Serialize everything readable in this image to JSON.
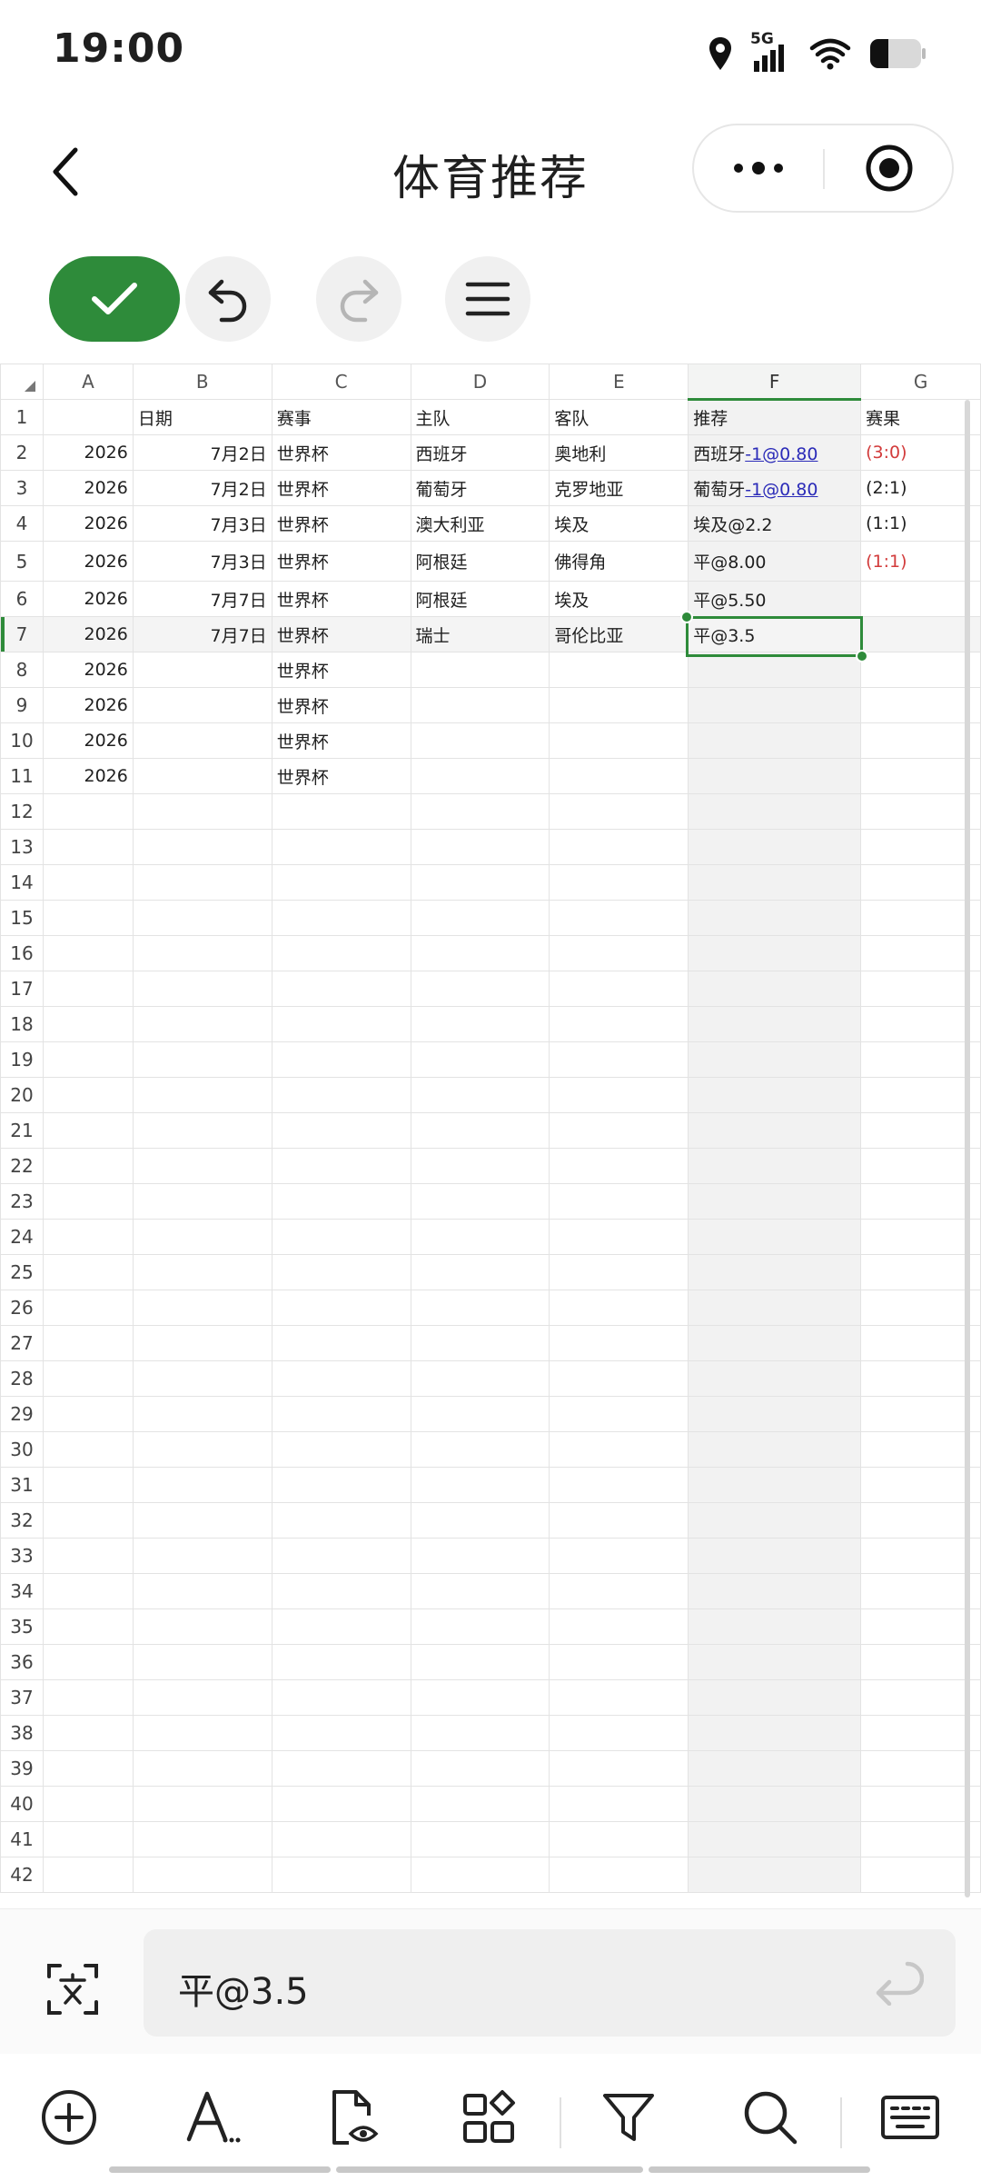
{
  "status_bar": {
    "time": "19:00",
    "network": "5G",
    "icons": [
      "location-icon",
      "signal-icon",
      "wifi-icon",
      "battery-icon"
    ]
  },
  "header": {
    "title": "体育推荐",
    "icons": [
      "back-icon",
      "more-icon",
      "target-icon"
    ]
  },
  "toolbar": {
    "icons": [
      "check-icon",
      "undo-icon",
      "redo-icon",
      "menu-icon"
    ],
    "accent": "#2e8b3a"
  },
  "sheet": {
    "columns": [
      "A",
      "B",
      "C",
      "D",
      "E",
      "F",
      "G"
    ],
    "selected_column": "F",
    "selected_row": 7,
    "selected_cell": "F7",
    "rows": [
      {
        "n": "1",
        "a": "",
        "b": "日期",
        "c": "赛事",
        "d": "主队",
        "e": "客队",
        "f_pre": "推荐",
        "f_link": "",
        "g": "赛果",
        "g_red": false
      },
      {
        "n": "2",
        "a": "2026",
        "b": "7月2日",
        "c": "世界杯",
        "d": "西班牙",
        "e": "奥地利",
        "f_pre": "西班牙",
        "f_link": "-1@0.80",
        "g": "(3:0)",
        "g_red": true
      },
      {
        "n": "3",
        "a": "2026",
        "b": "7月2日",
        "c": "世界杯",
        "d": "葡萄牙",
        "e": "克罗地亚",
        "f_pre": "葡萄牙",
        "f_link": "-1@0.80",
        "g": "(2:1)",
        "g_red": false
      },
      {
        "n": "4",
        "a": "2026",
        "b": "7月3日",
        "c": "世界杯",
        "d": "澳大利亚",
        "e": "埃及",
        "f_pre": "埃及@2.2",
        "f_link": "",
        "g": "(1:1)",
        "g_red": false
      },
      {
        "n": "5",
        "a": "2026",
        "b": "7月3日",
        "c": "世界杯",
        "d": "阿根廷",
        "e": "佛得角",
        "f_pre": "平@8.00",
        "f_link": "",
        "g": "(1:1)",
        "g_red": true
      },
      {
        "n": "6",
        "a": "2026",
        "b": "7月7日",
        "c": "世界杯",
        "d": "阿根廷",
        "e": "埃及",
        "f_pre": "平@5.50",
        "f_link": "",
        "g": "",
        "g_red": false
      },
      {
        "n": "7",
        "a": "2026",
        "b": "7月7日",
        "c": "世界杯",
        "d": "瑞士",
        "e": "哥伦比亚",
        "f_pre": "平@3.5",
        "f_link": "",
        "g": "",
        "g_red": false
      },
      {
        "n": "8",
        "a": "2026",
        "b": "",
        "c": "世界杯",
        "d": "",
        "e": "",
        "f_pre": "",
        "f_link": "",
        "g": "",
        "g_red": false
      },
      {
        "n": "9",
        "a": "2026",
        "b": "",
        "c": "世界杯",
        "d": "",
        "e": "",
        "f_pre": "",
        "f_link": "",
        "g": "",
        "g_red": false
      },
      {
        "n": "10",
        "a": "2026",
        "b": "",
        "c": "世界杯",
        "d": "",
        "e": "",
        "f_pre": "",
        "f_link": "",
        "g": "",
        "g_red": false
      },
      {
        "n": "11",
        "a": "2026",
        "b": "",
        "c": "世界杯",
        "d": "",
        "e": "",
        "f_pre": "",
        "f_link": "",
        "g": "",
        "g_red": false
      }
    ],
    "empty_rows_from": 12,
    "empty_rows_to": 42
  },
  "formula_bar": {
    "value": "平@3.5",
    "icons": [
      "text-recognition-icon",
      "enter-icon"
    ]
  },
  "bottom_toolbar": {
    "icons": [
      "add-icon",
      "text-format-icon",
      "file-preview-icon",
      "apps-icon",
      "filter-icon",
      "search-icon",
      "keyboard-icon"
    ]
  },
  "colors": {
    "accent": "#2e8b3a",
    "link": "#2b2bb8",
    "red": "#d23b3b"
  }
}
